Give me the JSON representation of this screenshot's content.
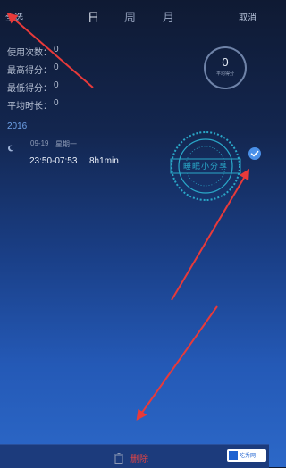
{
  "topbar": {
    "left_label": "全选",
    "right_label": "取消"
  },
  "tabs": [
    {
      "label": "日",
      "active": true
    },
    {
      "label": "周",
      "active": false
    },
    {
      "label": "月",
      "active": false
    }
  ],
  "stats": [
    {
      "label": "使用次数：",
      "value": "0"
    },
    {
      "label": "最高得分：",
      "value": "0"
    },
    {
      "label": "最低得分：",
      "value": "0"
    },
    {
      "label": "平均时长：",
      "value": "0"
    }
  ],
  "score_ring": {
    "value": "0",
    "label": "平均得分"
  },
  "year": "2016",
  "record": {
    "date": "09-19",
    "weekday": "星期一",
    "time_range": "23:50-07:53",
    "duration": "8h1min",
    "selected": true
  },
  "stamp_text": "睡眠小分享",
  "bottom": {
    "delete_label": "删除",
    "delete_color": "#e24444"
  },
  "watermark": "吃秀网"
}
